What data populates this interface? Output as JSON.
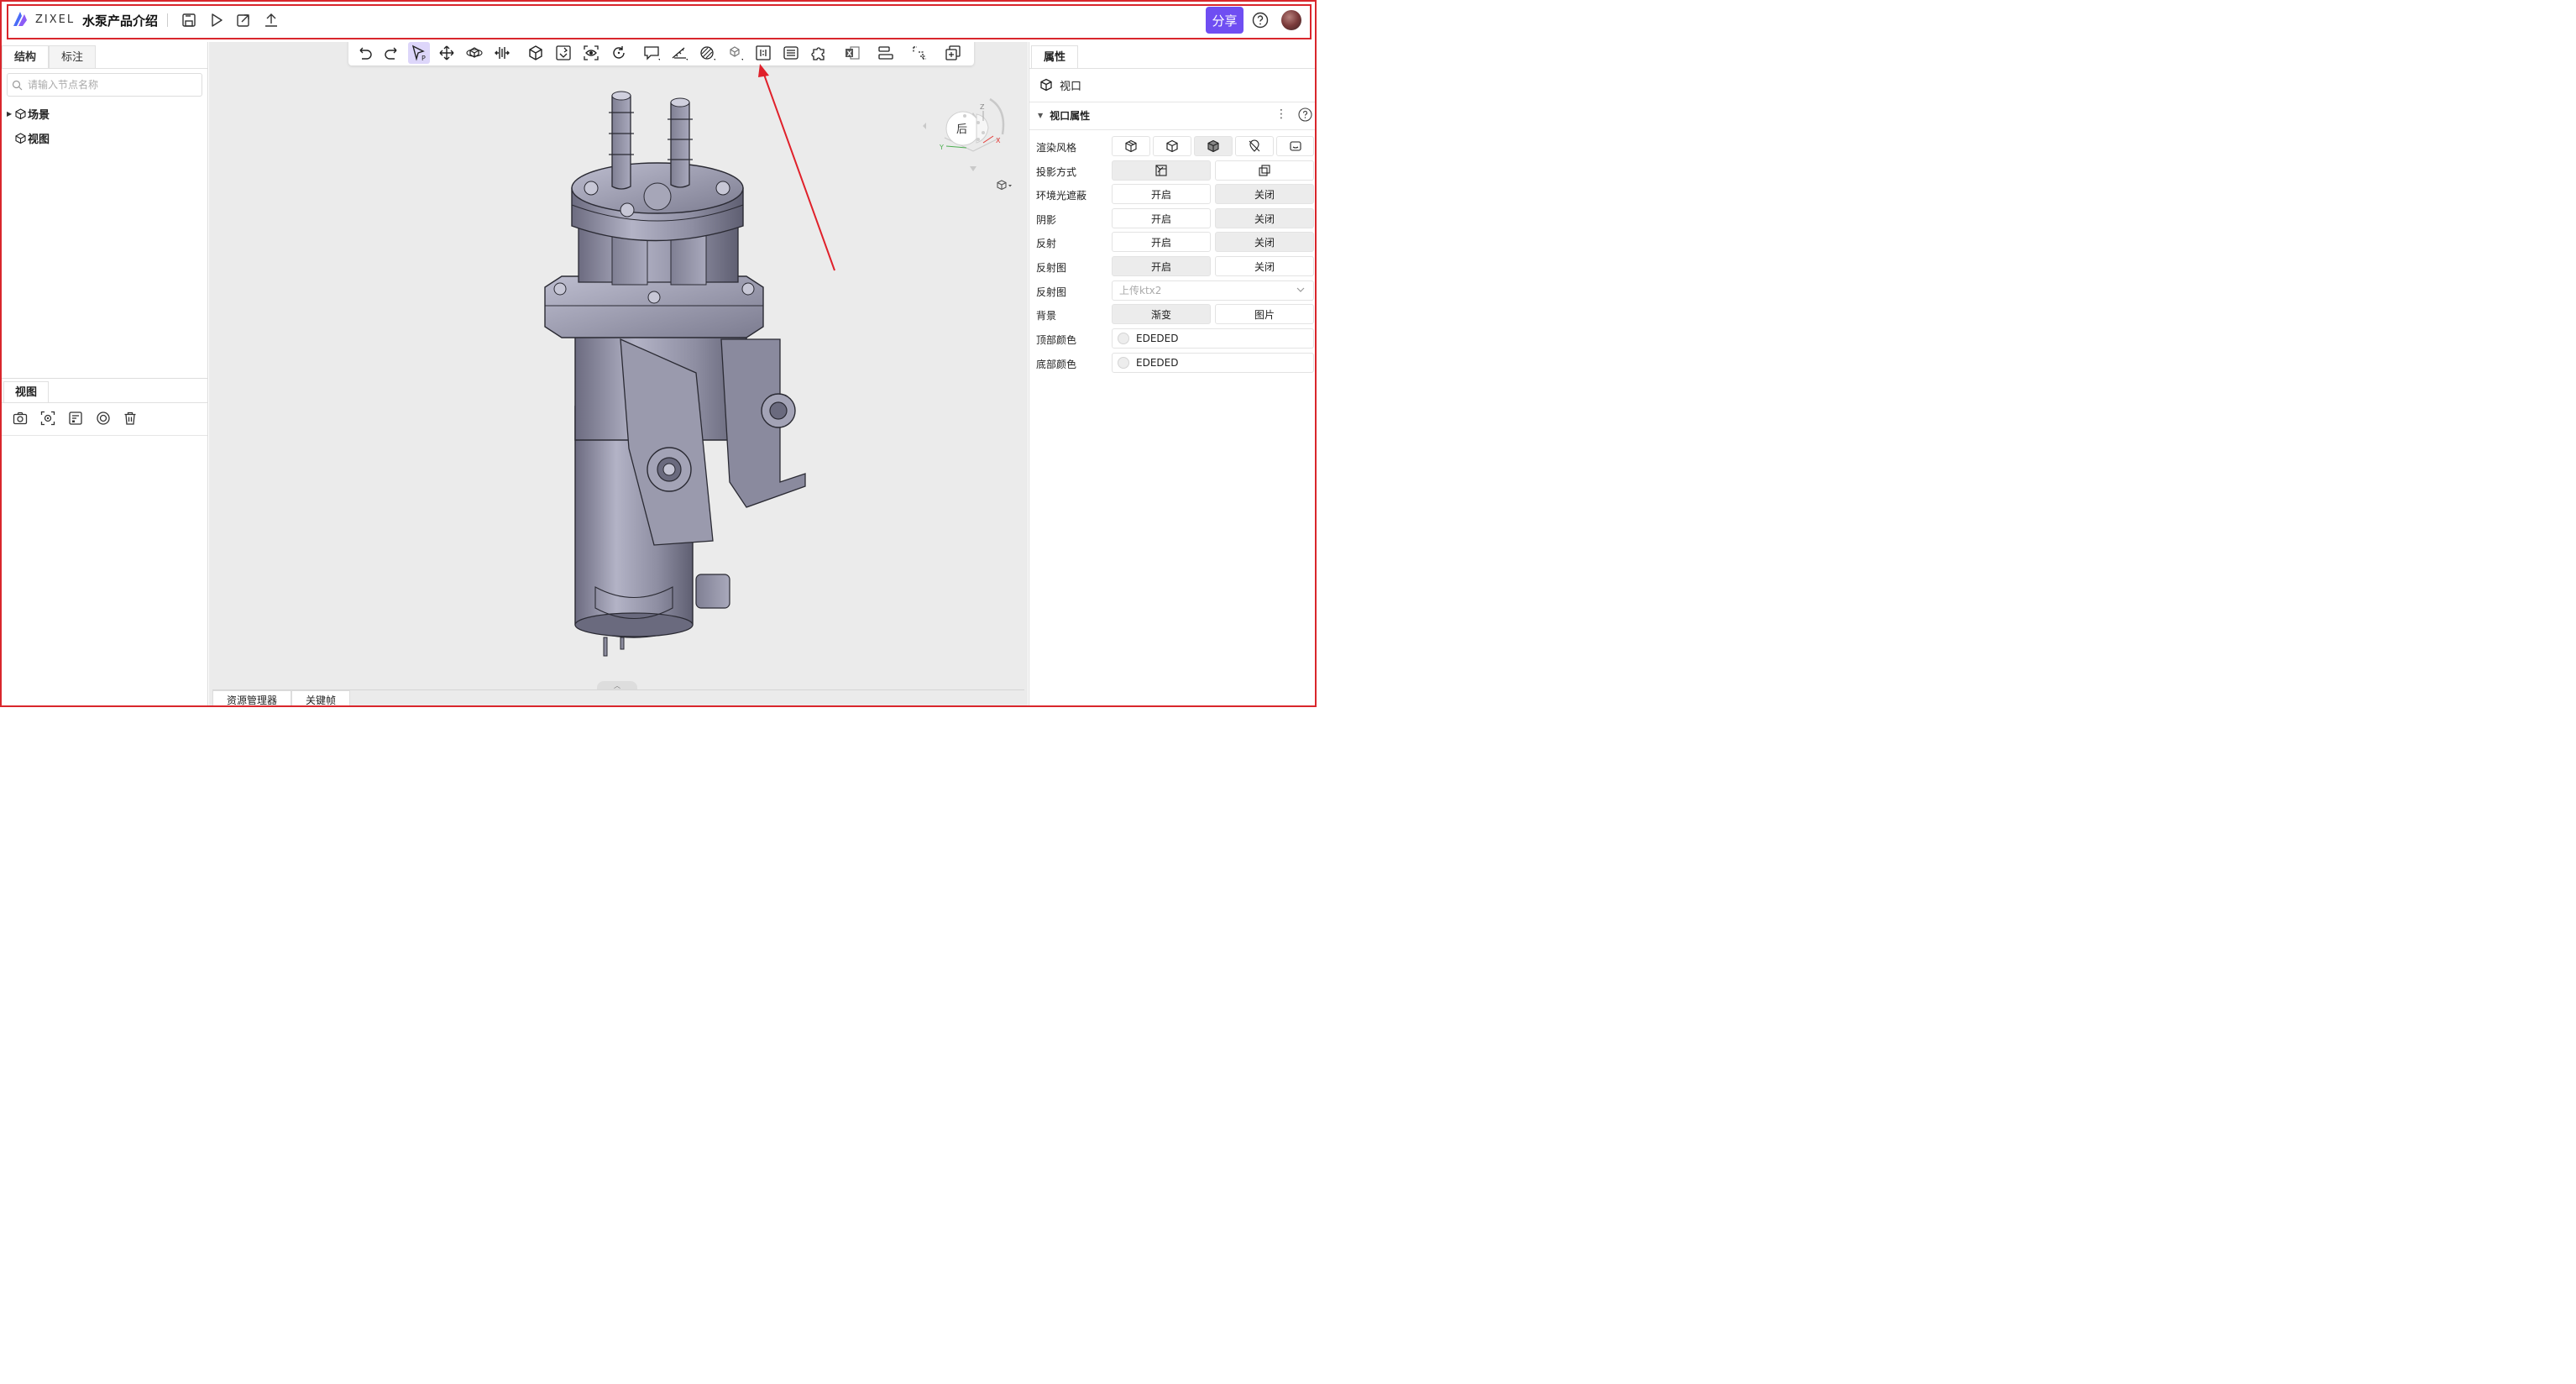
{
  "header": {
    "logo_text": "ZIXEL",
    "doc_title": "水泵产品介绍",
    "share_label": "分享"
  },
  "left_panel": {
    "tabs": [
      {
        "label": "结构"
      },
      {
        "label": "标注"
      }
    ],
    "search_placeholder": "请输入节点名称",
    "tree": [
      {
        "label": "场景"
      },
      {
        "label": "视图"
      }
    ],
    "view_tab": "视图"
  },
  "viewport": {
    "viewcube_face": "后",
    "axis_x": "X",
    "axis_y": "Y",
    "axis_z": "Z",
    "bottom_tabs": [
      {
        "label": "资源管理器"
      },
      {
        "label": "关键帧"
      }
    ]
  },
  "right_panel": {
    "tab": "属性",
    "object_label": "视口",
    "section_title": "视口属性",
    "props": {
      "render_style": "渲染风格",
      "projection": "投影方式",
      "ambient_occlusion": "环境光遮蔽",
      "shadow": "阴影",
      "reflection": "反射",
      "reflection_map": "反射图",
      "reflection_map_file": "反射图",
      "background": "背景",
      "top_color": "顶部颜色",
      "bottom_color": "底部颜色"
    },
    "on_label": "开启",
    "off_label": "关闭",
    "upload_placeholder": "上传ktx2",
    "bg_gradient": "渐变",
    "bg_image": "图片",
    "top_color_value": "EDEDED",
    "bottom_color_value": "EDEDED"
  },
  "colors": {
    "accent": "#6f4ef2",
    "highlight_border": "#d9262c",
    "viewport_bg": "#ebebeb",
    "model_body": "#8a8a9c"
  }
}
